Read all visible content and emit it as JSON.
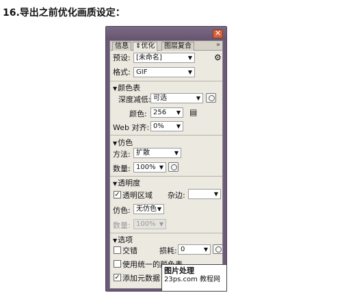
{
  "heading": "16.导出之前优化画质设定：",
  "tabs": [
    "信息",
    "优化",
    "图层复合"
  ],
  "preset": {
    "label": "预设:",
    "value": "[未命名]"
  },
  "format": {
    "label": "格式:",
    "value": "GIF"
  },
  "color_table": {
    "title": "颜色表",
    "depth_label": "深度减低:",
    "depth_value": "可选",
    "colors_label": "颜色:",
    "colors_value": "256",
    "web_snap_label": "Web 对齐:",
    "web_snap_value": "0%"
  },
  "dither": {
    "title": "仿色",
    "method_label": "方法:",
    "method_value": "扩散",
    "amount_label": "数量:",
    "amount_value": "100%"
  },
  "transparency": {
    "title": "透明度",
    "transparent_area_label": "透明区域",
    "matte_label": "杂边:",
    "matte_value": "",
    "dither_label": "仿色:",
    "dither_value": "无仿色",
    "amount_label": "数量:",
    "amount_value": "100%"
  },
  "options": {
    "title": "选项",
    "interlace_label": "交错",
    "lossy_label": "损耗:",
    "lossy_value": "0",
    "unified_colors_label": "使用统一的颜色表",
    "add_metadata_label": "添加元数据"
  },
  "watermark": {
    "line1": "图片处理",
    "line2": "23ps.com 教程网"
  }
}
